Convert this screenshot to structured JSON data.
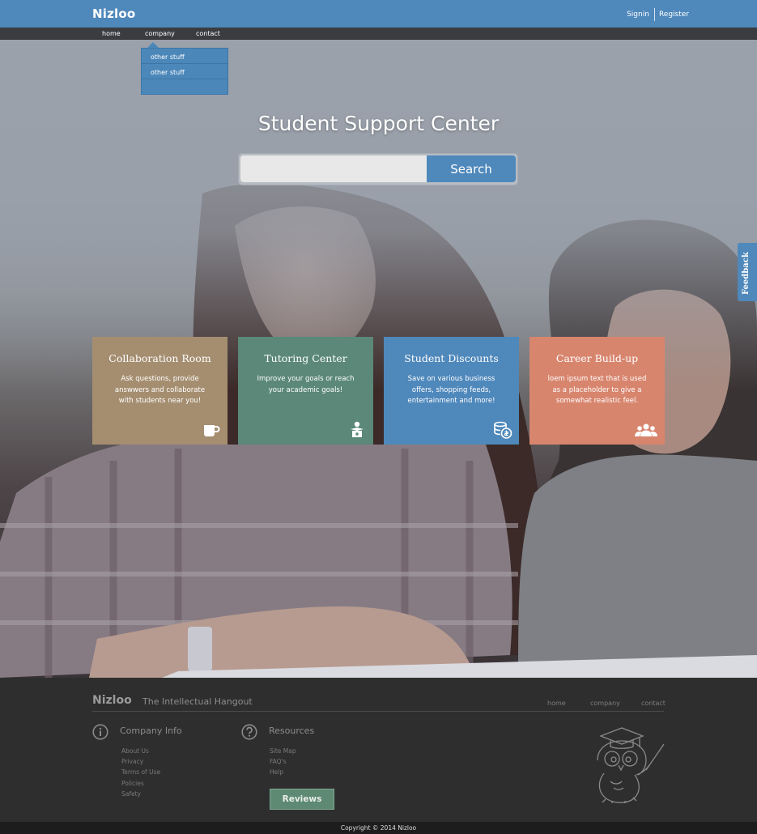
{
  "header": {
    "logo": "Nizloo",
    "signin": "Signin",
    "register": "Register",
    "nav": [
      "home",
      "company",
      "contact"
    ],
    "dropdown": [
      "other stuff",
      "other stuff"
    ]
  },
  "hero": {
    "title": "Student Support Center",
    "search_value": "",
    "search_button": "Search"
  },
  "feedback_tab": "Feedback",
  "cards": [
    {
      "title": "Collaboration Room",
      "desc": "Ask questions, provide answwers and collaborate with students near you!",
      "icon": "coffee-mug-icon",
      "color": "#a58e70"
    },
    {
      "title": "Tutoring Center",
      "desc": "Improve your goals or reach your academic goals!",
      "icon": "tutor-icon",
      "color": "#5b8878"
    },
    {
      "title": "Student Discounts",
      "desc": "Save on various business offers, shopping feeds, entertainment and more!",
      "icon": "coins-icon",
      "color": "#4f88bb"
    },
    {
      "title": "Career Build-up",
      "desc": "loem ipsum text that is used as a placeholder to give a somewhat realistic feel.",
      "icon": "people-icon",
      "color": "#d8856e"
    }
  ],
  "footer": {
    "logo": "Nizloo",
    "tagline": "The Intellectual Hangout",
    "nav": [
      "home",
      "company",
      "contact"
    ],
    "company_info": {
      "title": "Company Info",
      "links": [
        "About Us",
        "Privacy",
        "Terms of Use",
        "Policies",
        "Safety"
      ]
    },
    "resources": {
      "title": "Resources",
      "links": [
        "Site Map",
        "FAQ's",
        "Help"
      ]
    },
    "reviews_button": "Reviews",
    "copyright": "Copyright © 2014 Nizloo"
  },
  "colors": {
    "brand_blue": "#4f88bb",
    "navbar": "#3a3c40",
    "footer_bg": "#2e2e2e",
    "reviews_green": "#5e8a73"
  }
}
